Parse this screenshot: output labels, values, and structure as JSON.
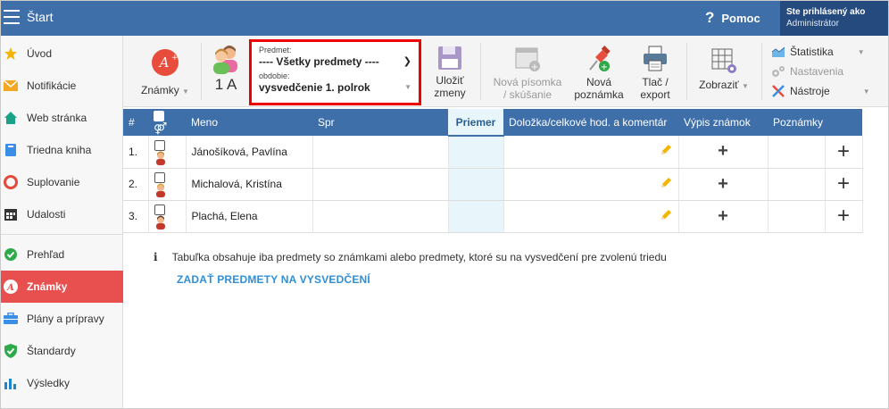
{
  "topbar": {
    "title": "Štart",
    "help": "Pomoc",
    "user_line1": "Ste prihlásený ako",
    "user_line2": "Administrátor"
  },
  "sidebar": {
    "items": [
      {
        "label": "Úvod",
        "icon": "star-icon"
      },
      {
        "label": "Notifikácie",
        "icon": "envelope-icon"
      },
      {
        "label": "Web stránka",
        "icon": "home-icon"
      },
      {
        "label": "Triedna kniha",
        "icon": "book-icon"
      },
      {
        "label": "Suplovanie",
        "icon": "lifebuoy-icon"
      },
      {
        "label": "Udalosti",
        "icon": "calendar-icon"
      },
      {
        "label": "Prehľad",
        "icon": "check-circle-icon"
      },
      {
        "label": "Známky",
        "icon": "grade-icon"
      },
      {
        "label": "Plány a prípravy",
        "icon": "briefcase-icon"
      },
      {
        "label": "Štandardy",
        "icon": "shield-icon"
      },
      {
        "label": "Výsledky",
        "icon": "bar-chart-icon"
      }
    ]
  },
  "toolbar": {
    "grades_label": "Známky",
    "class_label": "1 A",
    "subject_label": "Predmet:",
    "subject_value": "---- Všetky predmety ----",
    "period_label": "obdobie:",
    "period_value": "vysvedčenie 1. polrok",
    "save_line1": "Uložiť",
    "save_line2": "zmeny",
    "newtest_line1": "Nová písomka",
    "newtest_line2": "/ skúšanie",
    "newnote_line1": "Nová",
    "newnote_line2": "poznámka",
    "print_line1": "Tlač /",
    "print_line2": "export",
    "show_label": "Zobraziť",
    "stats_label": "Štatistika",
    "settings_label": "Nastavenia",
    "tools_label": "Nástroje"
  },
  "table": {
    "headers": {
      "num": "#",
      "name": "Meno",
      "spr": "Spr",
      "priemer": "Priemer",
      "dolozka": "Doložka/celkové hod. a komentár",
      "vypis": "Výpis známok",
      "poznamky": "Poznámky"
    },
    "rows": [
      {
        "num": "1.",
        "name": "Jánošíková, Pavlína"
      },
      {
        "num": "2.",
        "name": "Michalová, Kristína"
      },
      {
        "num": "3.",
        "name": "Plachá, Elena"
      }
    ]
  },
  "info_text": "Tabuľka obsahuje iba predmety so známkami alebo predmety, ktoré su na vysvedčení pre zvolenú triedu",
  "link_text": "ZADAŤ PREDMETY NA VYSVEDČENÍ",
  "colors": {
    "accent": "#3f6fa8",
    "active": "#e85050",
    "highlight": "#e00000",
    "link": "#2f8fd8"
  }
}
